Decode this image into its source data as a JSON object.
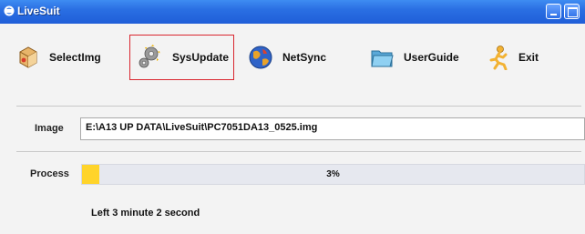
{
  "window": {
    "title": "LiveSuit"
  },
  "toolbar": {
    "buttons": [
      {
        "label": "SelectImg",
        "icon": "select-image-icon",
        "selected": false
      },
      {
        "label": "SysUpdate",
        "icon": "gear-update-icon",
        "selected": true
      },
      {
        "label": "NetSync",
        "icon": "globe-sync-icon",
        "selected": false
      },
      {
        "label": "UserGuide",
        "icon": "folder-guide-icon",
        "selected": false
      },
      {
        "label": "Exit",
        "icon": "running-man-icon",
        "selected": false
      }
    ]
  },
  "image": {
    "label": "Image",
    "path": "E:\\A13 UP DATA\\LiveSuit\\PC7051DA13_0525.img"
  },
  "process": {
    "label": "Process",
    "progress_percent": 3,
    "progress_text": "3%"
  },
  "status": {
    "text": "Left 3 minute 2 second"
  },
  "colors": {
    "titlebar": "#2a6fe3",
    "progress_fill": "#ffd42a",
    "selected_border": "#d9262f"
  }
}
